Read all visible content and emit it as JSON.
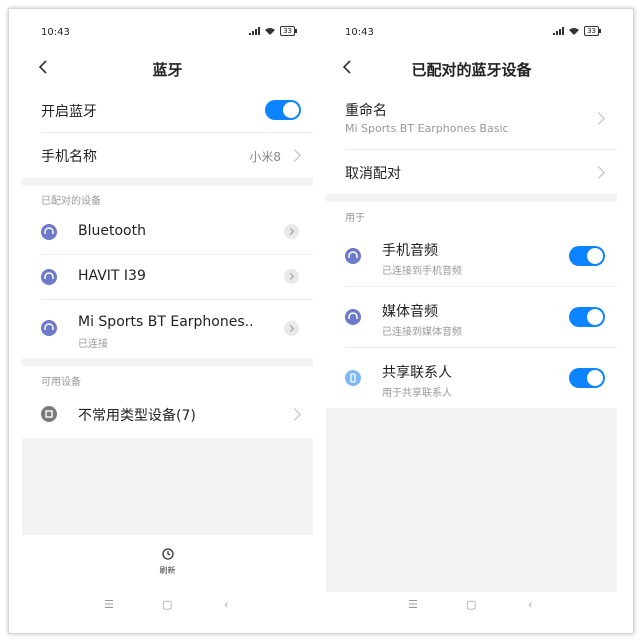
{
  "left": {
    "status": {
      "time": "10:43",
      "battery": "33"
    },
    "title": "蓝牙",
    "bt_toggle_label": "开启蓝牙",
    "phone_name_label": "手机名称",
    "phone_name_value": "小米8",
    "paired_header": "已配对的设备",
    "paired": [
      {
        "name": "Bluetooth",
        "icon": "headset-icon"
      },
      {
        "name": "HAVIT I39",
        "icon": "headset-icon"
      },
      {
        "name": "Mi Sports BT Earphones..",
        "status": "已连接",
        "icon": "headset-icon"
      }
    ],
    "available_header": "可用设备",
    "available": [
      {
        "name": "不常用类型设备(7)",
        "icon": "device-icon"
      }
    ],
    "refresh_label": "刷新"
  },
  "right": {
    "status": {
      "time": "10:43",
      "battery": "33"
    },
    "title": "已配对的蓝牙设备",
    "rename_label": "重命名",
    "rename_sub": "Mi Sports BT Earphones Basic",
    "unpair_label": "取消配对",
    "use_header": "用于",
    "profiles": [
      {
        "name": "手机音频",
        "sub": "已连接到手机音频",
        "on": true,
        "icon": "headset-icon"
      },
      {
        "name": "媒体音频",
        "sub": "已连接到媒体音频",
        "on": true,
        "icon": "headset-icon"
      },
      {
        "name": "共享联系人",
        "sub": "用于共享联系人",
        "on": true,
        "icon": "phone-icon"
      }
    ]
  },
  "colors": {
    "accent": "#0d84ff",
    "headset_icon": "#6d79c9",
    "section_bg": "#f3f3f3"
  }
}
